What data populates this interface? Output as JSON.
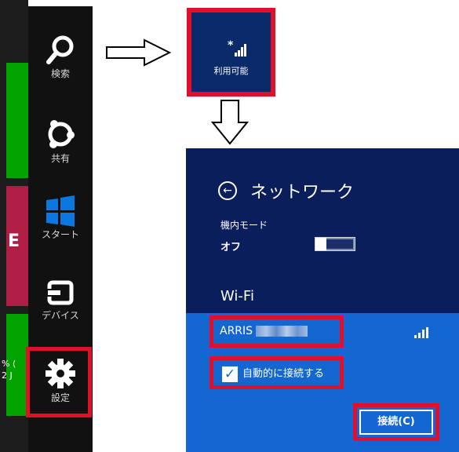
{
  "start_screen_edge": {
    "tile_text_1": "% (",
    "tile_text_2": "2 J",
    "tile_glyph": "E"
  },
  "charms": [
    {
      "label": "検索",
      "icon": "search-icon"
    },
    {
      "label": "共有",
      "icon": "share-icon"
    },
    {
      "label": "スタート",
      "icon": "windows-logo-icon"
    },
    {
      "label": "デバイス",
      "icon": "devices-icon"
    },
    {
      "label": "設定",
      "icon": "gear-icon"
    }
  ],
  "network_tile": {
    "status": "利用可能",
    "icon": "wifi-signal-available-icon"
  },
  "network_pane": {
    "title": "ネットワーク",
    "airplane_mode_label": "機内モード",
    "airplane_mode_value": "オフ",
    "wifi_section": "Wi-Fi",
    "network_name": "ARRIS",
    "auto_connect_label": "自動的に接続する",
    "auto_connect_checked": true,
    "connect_button": "接続(C)"
  },
  "colors": {
    "highlight": "#e0102a",
    "pane_bg": "#0a1e5c",
    "selected_bg": "#1466d0",
    "charms_bg": "#111111"
  }
}
